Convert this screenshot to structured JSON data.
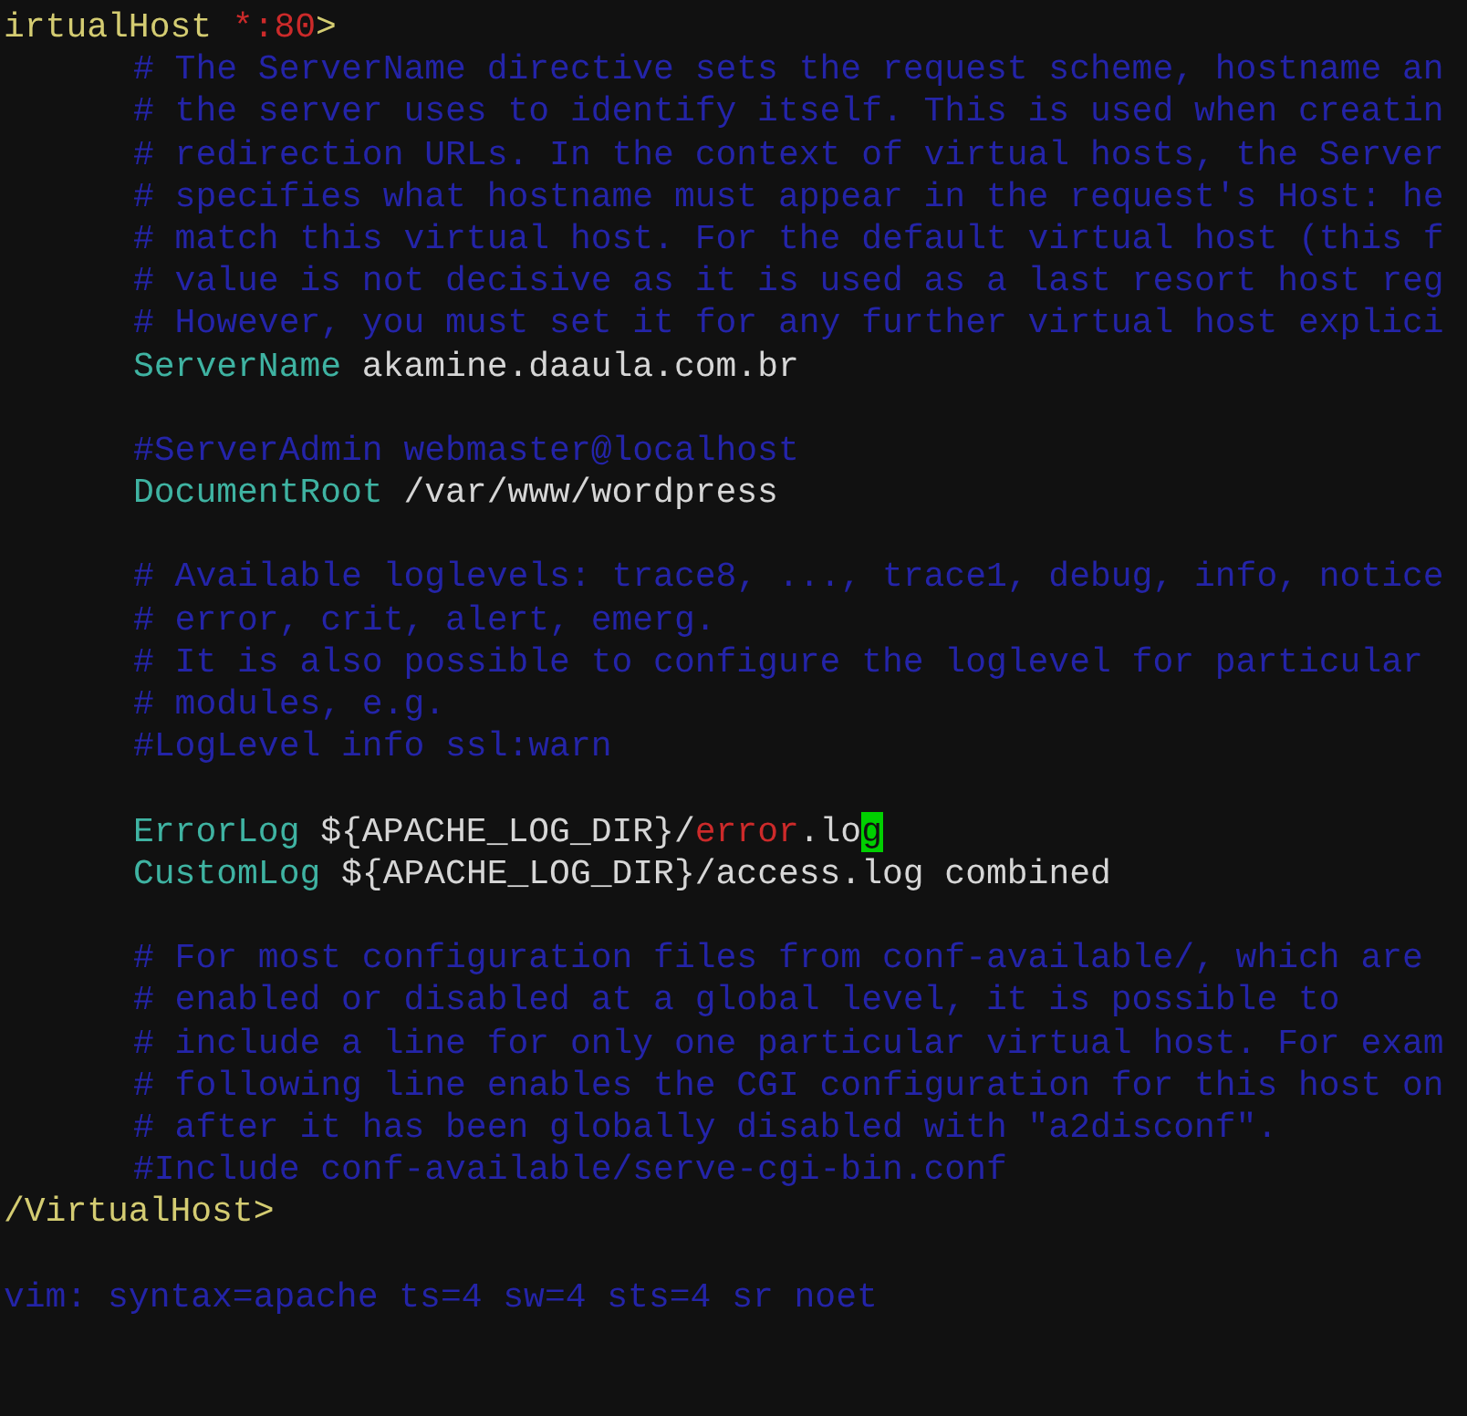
{
  "lines": [
    {
      "kind": "code",
      "indent": false,
      "segments": [
        {
          "kind": "tag",
          "text": "irtualHost "
        },
        {
          "kind": "error",
          "text": "*:80"
        },
        {
          "kind": "tag",
          "text": ">"
        }
      ]
    },
    {
      "kind": "code",
      "indent": true,
      "segments": [
        {
          "kind": "comment",
          "text": "# The ServerName directive sets the request scheme, hostname an"
        }
      ]
    },
    {
      "kind": "code",
      "indent": true,
      "segments": [
        {
          "kind": "comment",
          "text": "# the server uses to identify itself. This is used when creatin"
        }
      ]
    },
    {
      "kind": "code",
      "indent": true,
      "segments": [
        {
          "kind": "comment",
          "text": "# redirection URLs. In the context of virtual hosts, the Server"
        }
      ]
    },
    {
      "kind": "code",
      "indent": true,
      "segments": [
        {
          "kind": "comment",
          "text": "# specifies what hostname must appear in the request's Host: he"
        }
      ]
    },
    {
      "kind": "code",
      "indent": true,
      "segments": [
        {
          "kind": "comment",
          "text": "# match this virtual host. For the default virtual host (this f"
        }
      ]
    },
    {
      "kind": "code",
      "indent": true,
      "segments": [
        {
          "kind": "comment",
          "text": "# value is not decisive as it is used as a last resort host reg"
        }
      ]
    },
    {
      "kind": "code",
      "indent": true,
      "segments": [
        {
          "kind": "comment",
          "text": "# However, you must set it for any further virtual host explici"
        }
      ]
    },
    {
      "kind": "code",
      "indent": true,
      "segments": [
        {
          "kind": "keyword",
          "text": "ServerName"
        },
        {
          "kind": "plain",
          "text": " akamine.daaula.com.br"
        }
      ]
    },
    {
      "kind": "blank"
    },
    {
      "kind": "code",
      "indent": true,
      "segments": [
        {
          "kind": "comment",
          "text": "#ServerAdmin webmaster@localhost"
        }
      ]
    },
    {
      "kind": "code",
      "indent": true,
      "segments": [
        {
          "kind": "keyword",
          "text": "DocumentRoot"
        },
        {
          "kind": "plain",
          "text": " /var/www/wordpress"
        }
      ]
    },
    {
      "kind": "blank"
    },
    {
      "kind": "code",
      "indent": true,
      "segments": [
        {
          "kind": "comment",
          "text": "# Available loglevels: trace8, ..., trace1, debug, info, notice"
        }
      ]
    },
    {
      "kind": "code",
      "indent": true,
      "segments": [
        {
          "kind": "comment",
          "text": "# error, crit, alert, emerg."
        }
      ]
    },
    {
      "kind": "code",
      "indent": true,
      "segments": [
        {
          "kind": "comment",
          "text": "# It is also possible to configure the loglevel for particular"
        }
      ]
    },
    {
      "kind": "code",
      "indent": true,
      "segments": [
        {
          "kind": "comment",
          "text": "# modules, e.g."
        }
      ]
    },
    {
      "kind": "code",
      "indent": true,
      "segments": [
        {
          "kind": "comment",
          "text": "#LogLevel info ssl:warn"
        }
      ]
    },
    {
      "kind": "blank"
    },
    {
      "kind": "code",
      "indent": true,
      "segments": [
        {
          "kind": "keyword",
          "text": "ErrorLog"
        },
        {
          "kind": "plain",
          "text": " ${APACHE_LOG_DIR}/"
        },
        {
          "kind": "error",
          "text": "error"
        },
        {
          "kind": "plain",
          "text": ".lo"
        },
        {
          "kind": "cursor",
          "text": "g"
        }
      ]
    },
    {
      "kind": "code",
      "indent": true,
      "segments": [
        {
          "kind": "keyword",
          "text": "CustomLog"
        },
        {
          "kind": "plain",
          "text": " ${APACHE_LOG_DIR}/access.log combined"
        }
      ]
    },
    {
      "kind": "blank"
    },
    {
      "kind": "code",
      "indent": true,
      "segments": [
        {
          "kind": "comment",
          "text": "# For most configuration files from conf-available/, which are"
        }
      ]
    },
    {
      "kind": "code",
      "indent": true,
      "segments": [
        {
          "kind": "comment",
          "text": "# enabled or disabled at a global level, it is possible to"
        }
      ]
    },
    {
      "kind": "code",
      "indent": true,
      "segments": [
        {
          "kind": "comment",
          "text": "# include a line for only one particular virtual host. For exam"
        }
      ]
    },
    {
      "kind": "code",
      "indent": true,
      "segments": [
        {
          "kind": "comment",
          "text": "# following line enables the CGI configuration for this host on"
        }
      ]
    },
    {
      "kind": "code",
      "indent": true,
      "segments": [
        {
          "kind": "comment",
          "text": "# after it has been globally disabled with \"a2disconf\"."
        }
      ]
    },
    {
      "kind": "code",
      "indent": true,
      "segments": [
        {
          "kind": "comment",
          "text": "#Include conf-available/serve-cgi-bin.conf"
        }
      ]
    },
    {
      "kind": "code",
      "indent": false,
      "segments": [
        {
          "kind": "tag",
          "text": "/VirtualHost>"
        }
      ]
    },
    {
      "kind": "blank"
    },
    {
      "kind": "code",
      "indent": false,
      "segments": [
        {
          "kind": "comment",
          "text": "vim: syntax=apache ts=4 sw=4 sts=4 sr noet"
        }
      ]
    }
  ]
}
